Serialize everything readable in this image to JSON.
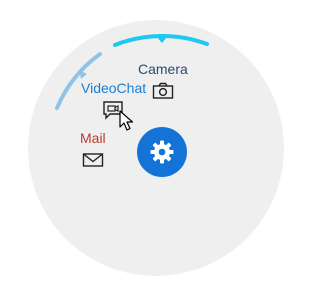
{
  "menu": {
    "colors": {
      "disc": "#efefef",
      "accent": "#1fc8f0",
      "accent_light": "#8fc3e8",
      "center": "#1473d6",
      "camera_label": "#2a4a7a",
      "videochat_label": "#1a7fd6",
      "mail_label": "#c0392b",
      "icon_stroke": "#222222"
    },
    "items": [
      {
        "label": "Camera",
        "icon": "camera-icon"
      },
      {
        "label": "VideoChat",
        "icon": "video-chat-icon"
      },
      {
        "label": "Mail",
        "icon": "mail-icon"
      }
    ],
    "center_icon": "gear-icon",
    "cursor_icon": "mouse-pointer-icon"
  }
}
